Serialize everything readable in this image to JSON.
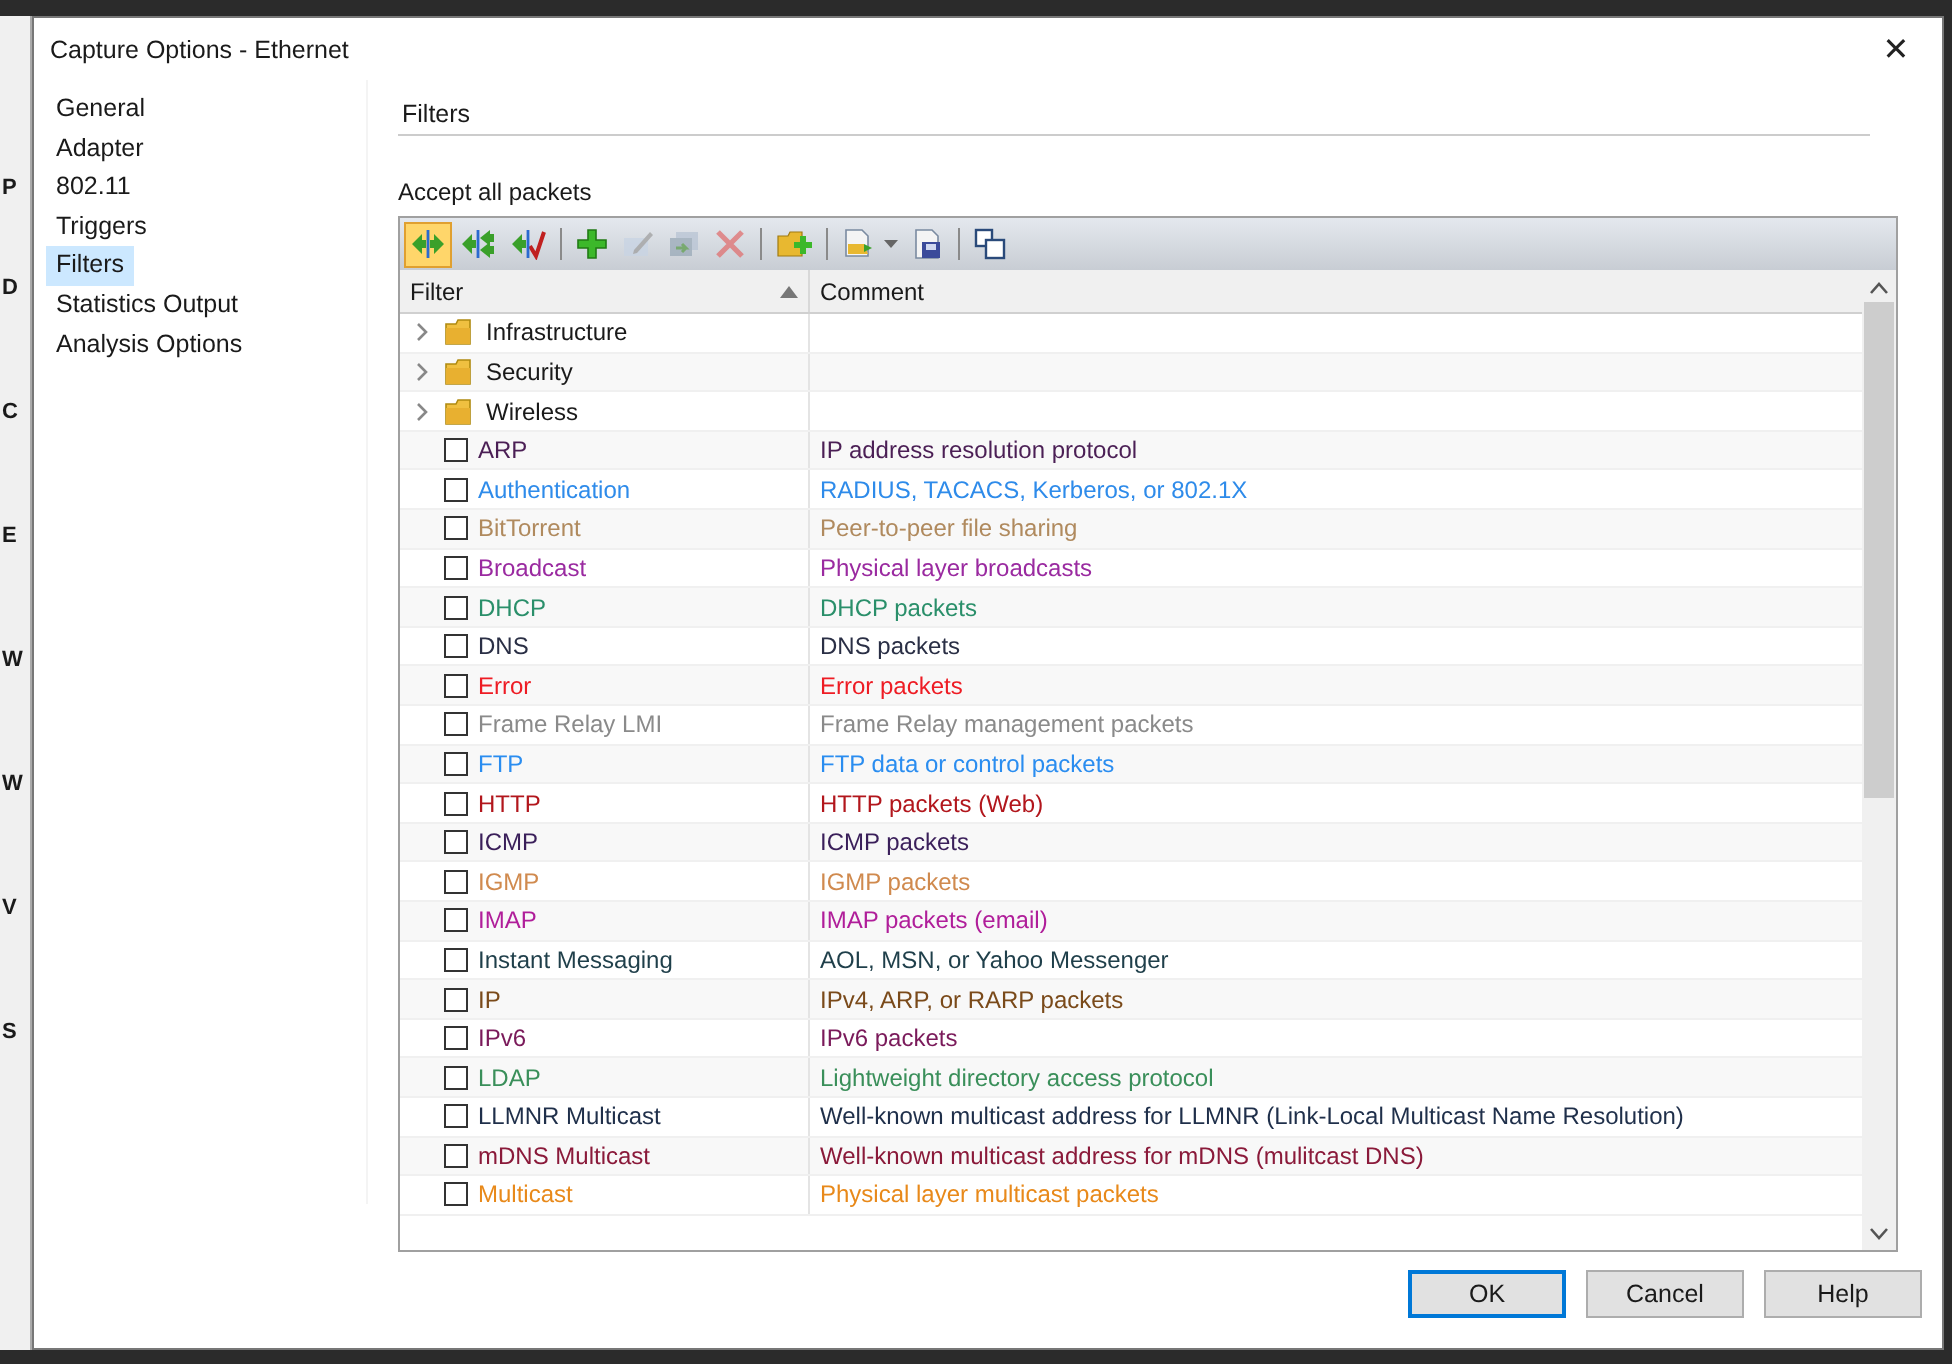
{
  "background_window": {
    "letters": [
      "P",
      "D",
      "C",
      "E",
      "W",
      "W",
      "V",
      "S"
    ]
  },
  "window": {
    "title": "Capture Options - Ethernet",
    "close": "✕"
  },
  "sidebar": {
    "items": [
      {
        "label": "General",
        "selected": false
      },
      {
        "label": "Adapter",
        "selected": false
      },
      {
        "label": "802.11",
        "selected": false
      },
      {
        "label": "Triggers",
        "selected": false
      },
      {
        "label": "Filters",
        "selected": true
      },
      {
        "label": "Statistics Output",
        "selected": false
      },
      {
        "label": "Analysis Options",
        "selected": false
      }
    ]
  },
  "section": {
    "title": "Filters",
    "mode": "Accept all packets"
  },
  "toolbar": [
    {
      "kind": "accept",
      "selected": true,
      "disabled": false
    },
    {
      "kind": "reject",
      "selected": false,
      "disabled": false
    },
    {
      "kind": "check",
      "selected": false,
      "disabled": false
    },
    {
      "kind": "sep"
    },
    {
      "kind": "add",
      "selected": false,
      "disabled": false
    },
    {
      "kind": "edit",
      "selected": false,
      "disabled": true
    },
    {
      "kind": "duplicate",
      "selected": false,
      "disabled": true
    },
    {
      "kind": "delete",
      "selected": false,
      "disabled": true
    },
    {
      "kind": "sep"
    },
    {
      "kind": "newfolder",
      "selected": false,
      "disabled": false
    },
    {
      "kind": "sep"
    },
    {
      "kind": "open",
      "selected": false,
      "disabled": false
    },
    {
      "kind": "save",
      "selected": false,
      "disabled": false
    },
    {
      "kind": "sep"
    },
    {
      "kind": "windows",
      "selected": false,
      "disabled": false
    }
  ],
  "table": {
    "columns": [
      "Filter",
      "Comment"
    ],
    "rows": [
      {
        "kind": "folder",
        "name": "Infrastructure",
        "expanded": false
      },
      {
        "kind": "folder",
        "name": "Security",
        "expanded": false
      },
      {
        "kind": "folder",
        "name": "Wireless",
        "expanded": false
      },
      {
        "kind": "filter",
        "name": "ARP",
        "comment": "IP address resolution protocol",
        "checked": false,
        "color": "#4b1f55"
      },
      {
        "kind": "filter",
        "name": "Authentication",
        "comment": "RADIUS, TACACS, Kerberos, or 802.1X",
        "checked": false,
        "color": "#2e8bea"
      },
      {
        "kind": "filter",
        "name": "BitTorrent",
        "comment": "Peer-to-peer file sharing",
        "checked": false,
        "color": "#b08a5e"
      },
      {
        "kind": "filter",
        "name": "Broadcast",
        "comment": "Physical layer broadcasts",
        "checked": false,
        "color": "#9a2aa0"
      },
      {
        "kind": "filter",
        "name": "DHCP",
        "comment": "DHCP packets",
        "checked": false,
        "color": "#2a8f6a"
      },
      {
        "kind": "filter",
        "name": "DNS",
        "comment": "DNS packets",
        "checked": false,
        "color": "#2a2f45"
      },
      {
        "kind": "filter",
        "name": "Error",
        "comment": "Error packets",
        "checked": false,
        "color": "#ee1c24"
      },
      {
        "kind": "filter",
        "name": "Frame Relay LMI",
        "comment": "Frame Relay management packets",
        "checked": false,
        "color": "#8a8a8a"
      },
      {
        "kind": "filter",
        "name": "FTP",
        "comment": "FTP data or control packets",
        "checked": false,
        "color": "#2a8df0"
      },
      {
        "kind": "filter",
        "name": "HTTP",
        "comment": "HTTP packets (Web)",
        "checked": false,
        "color": "#b2161c"
      },
      {
        "kind": "filter",
        "name": "ICMP",
        "comment": "ICMP packets",
        "checked": false,
        "color": "#3a1f5a"
      },
      {
        "kind": "filter",
        "name": "IGMP",
        "comment": "IGMP packets",
        "checked": false,
        "color": "#d08a4e"
      },
      {
        "kind": "filter",
        "name": "IMAP",
        "comment": "IMAP packets (email)",
        "checked": false,
        "color": "#b01e9a"
      },
      {
        "kind": "filter",
        "name": "Instant Messaging",
        "comment": "AOL, MSN, or Yahoo Messenger",
        "checked": false,
        "color": "#1f3f4a"
      },
      {
        "kind": "filter",
        "name": "IP",
        "comment": "IPv4, ARP, or RARP packets",
        "checked": false,
        "color": "#7a4a1a"
      },
      {
        "kind": "filter",
        "name": "IPv6",
        "comment": "IPv6 packets",
        "checked": false,
        "color": "#7a1a5a"
      },
      {
        "kind": "filter",
        "name": "LDAP",
        "comment": "Lightweight directory access protocol",
        "checked": false,
        "color": "#3a8f5a"
      },
      {
        "kind": "filter",
        "name": "LLMNR Multicast",
        "comment": "Well-known multicast address for LLMNR (Link-Local Multicast Name Resolution)",
        "checked": false,
        "color": "#1f2f4a"
      },
      {
        "kind": "filter",
        "name": "mDNS Multicast",
        "comment": "Well-known multicast address for mDNS (mulitcast DNS)",
        "checked": false,
        "color": "#8a1a3a"
      },
      {
        "kind": "filter",
        "name": "Multicast",
        "comment": "Physical layer multicast packets",
        "checked": false,
        "color": "#e8891a"
      }
    ]
  },
  "buttons": [
    {
      "label": "OK",
      "default": true
    },
    {
      "label": "Cancel",
      "default": false
    },
    {
      "label": "Help",
      "default": false
    }
  ]
}
